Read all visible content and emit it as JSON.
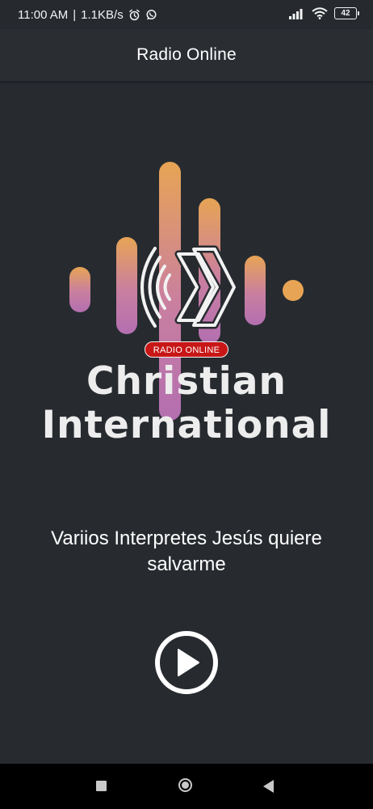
{
  "status_bar": {
    "time": "11:00 AM",
    "separator": "|",
    "speed": "1.1KB/s",
    "battery": "42",
    "icons": [
      "alarm-icon",
      "whatsapp-icon",
      "signal-icon",
      "wifi-icon",
      "battery-icon"
    ]
  },
  "app_bar": {
    "title": "Radio Online"
  },
  "logo": {
    "badge": "RADIO ONLINE",
    "line1": "Christian",
    "line2": "International",
    "gradient_top": "#e7a454",
    "gradient_bottom": "#b36fb0"
  },
  "player": {
    "track_title": "Variios Interpretes Jesús quiere salvarme",
    "state_icon": "play-icon"
  },
  "nav_bar": {
    "icons": [
      "recents-icon",
      "home-icon",
      "back-icon"
    ]
  },
  "colors": {
    "background": "#272b30",
    "app_bar": "#2a2e33",
    "badge_red": "#c81616",
    "text": "#ffffff"
  }
}
